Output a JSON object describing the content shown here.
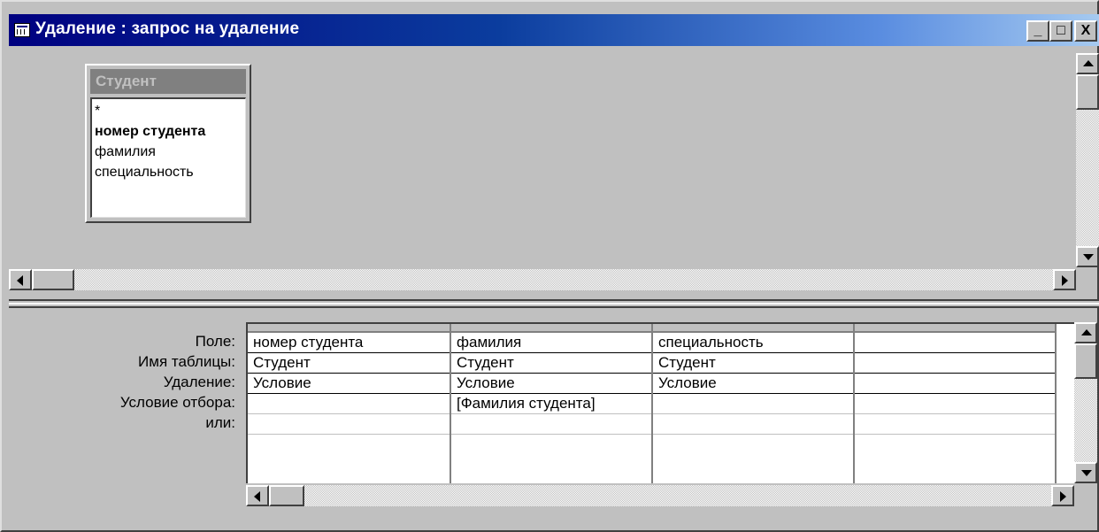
{
  "window": {
    "title": "Удаление : запрос на удаление",
    "controls": {
      "minimize": "_",
      "maximize": "□",
      "close": "X"
    }
  },
  "table_box": {
    "title": "Студент",
    "fields": [
      "*",
      "номер студента",
      "фамилия",
      "специальность"
    ],
    "primary_key": "номер студента"
  },
  "grid": {
    "row_labels": [
      "Поле:",
      "Имя таблицы:",
      "Удаление:",
      "Условие отбора:",
      "или:"
    ],
    "columns": [
      {
        "field": "номер студента",
        "table": "Студент",
        "delete": "Условие",
        "criteria": "",
        "or": ""
      },
      {
        "field": "фамилия",
        "table": "Студент",
        "delete": "Условие",
        "criteria": "[Фамилия студента]",
        "or": ""
      },
      {
        "field": "специальность",
        "table": "Студент",
        "delete": "Условие",
        "criteria": "",
        "or": ""
      },
      {
        "field": "",
        "table": "",
        "delete": "",
        "criteria": "",
        "or": ""
      }
    ]
  },
  "colors": {
    "title_gradient_start": "#000080",
    "title_gradient_end": "#a6caf0",
    "face": "#c0c0c0",
    "inactive_table_title": "#808080"
  }
}
